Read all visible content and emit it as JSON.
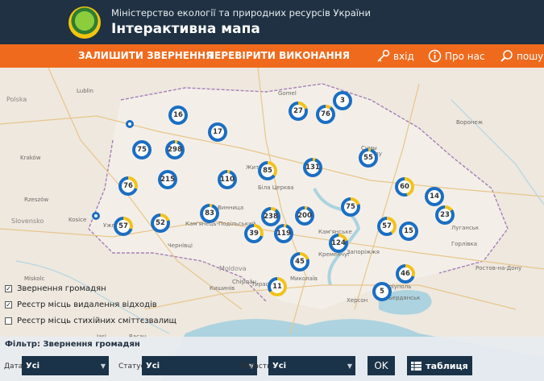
{
  "header": {
    "ministry": "Міністерство екології та природних ресурсів України",
    "title": "Інтерактивна мапа",
    "logo_icon": "ministry-emblem"
  },
  "nav": {
    "submit": "ЗАЛИШИТИ ЗВЕРНЕННЯ",
    "check": "ПЕРЕВІРИТИ ВИКОНАННЯ",
    "login": "вхід",
    "about": "Про нас",
    "search": "пошук",
    "accent": "#ef6a1d"
  },
  "map_labels": [
    {
      "text": "Polska",
      "cls": "country"
    },
    {
      "text": "Slovensko",
      "cls": "country"
    },
    {
      "text": "Moldova",
      "cls": "country"
    },
    {
      "text": "Gomel",
      "cls": ""
    },
    {
      "text": "Сумы",
      "cls": ""
    },
    {
      "text": "Воронеж",
      "cls": ""
    },
    {
      "text": "Kraków",
      "cls": ""
    },
    {
      "text": "Rzeszów",
      "cls": ""
    },
    {
      "text": "Lublin",
      "cls": ""
    },
    {
      "text": "Житомир",
      "cls": ""
    },
    {
      "text": "Біла Церква",
      "cls": ""
    },
    {
      "text": "Винница",
      "cls": ""
    },
    {
      "text": "Кам'янець-Подільський",
      "cls": ""
    },
    {
      "text": "Ужгород",
      "cls": ""
    },
    {
      "text": "Чернівці",
      "cls": ""
    },
    {
      "text": "Кременчуг",
      "cls": ""
    },
    {
      "text": "Запоріжжя",
      "cls": ""
    },
    {
      "text": "Кам'янське",
      "cls": ""
    },
    {
      "text": "Маріуполь",
      "cls": ""
    },
    {
      "text": "Бердянськ",
      "cls": ""
    },
    {
      "text": "Луганськ",
      "cls": ""
    },
    {
      "text": "Ростов-на-Дону",
      "cls": ""
    },
    {
      "text": "Миколаїв",
      "cls": ""
    },
    {
      "text": "Chişinău",
      "cls": ""
    },
    {
      "text": "Тирасполь",
      "cls": ""
    },
    {
      "text": "Херсон",
      "cls": ""
    },
    {
      "text": "Кишинів",
      "cls": ""
    },
    {
      "text": "Горлівка",
      "cls": ""
    },
    {
      "text": "Kosice",
      "cls": ""
    },
    {
      "text": "Miskolc",
      "cls": ""
    },
    {
      "text": "Iasi",
      "cls": ""
    },
    {
      "text": "Bacau",
      "cls": ""
    },
    {
      "text": "Sumy",
      "cls": ""
    }
  ],
  "clusters": [
    {
      "count": "3",
      "yellow": 0
    },
    {
      "count": "27",
      "yellow": 0.2
    },
    {
      "count": "76",
      "yellow": 0.1
    },
    {
      "count": "16",
      "yellow": 0
    },
    {
      "count": "17",
      "yellow": 0
    },
    {
      "count": "75",
      "yellow": 0
    },
    {
      "count": "298",
      "yellow": 0.05
    },
    {
      "count": "215",
      "yellow": 0
    },
    {
      "count": "76",
      "yellow": 0.3
    },
    {
      "count": "110",
      "yellow": 0.05
    },
    {
      "count": "85",
      "yellow": 0.35
    },
    {
      "count": "131",
      "yellow": 0.05
    },
    {
      "count": "55",
      "yellow": 0.05
    },
    {
      "count": "60",
      "yellow": 0.45
    },
    {
      "count": "14",
      "yellow": 0
    },
    {
      "count": "23",
      "yellow": 0.15
    },
    {
      "count": "57",
      "yellow": 0.3
    },
    {
      "count": "52",
      "yellow": 0.2
    },
    {
      "count": "83",
      "yellow": 0.05
    },
    {
      "count": "238",
      "yellow": 0.1
    },
    {
      "count": "200",
      "yellow": 0.05
    },
    {
      "count": "75",
      "yellow": 0.2
    },
    {
      "count": "57",
      "yellow": 0.4
    },
    {
      "count": "15",
      "yellow": 0
    },
    {
      "count": "39",
      "yellow": 0.3
    },
    {
      "count": "119",
      "yellow": 0.05
    },
    {
      "count": "124",
      "yellow": 0.2
    },
    {
      "count": "45",
      "yellow": 0.2
    },
    {
      "count": "46",
      "yellow": 0.3
    },
    {
      "count": "11",
      "yellow": 0.65
    },
    {
      "count": "5",
      "yellow": 0
    }
  ],
  "layers": [
    {
      "label": "Звернення громадян",
      "checked": true
    },
    {
      "label": "Реєстр місць видалення відходів",
      "checked": true
    },
    {
      "label": "Реєстр місць стихійних сміттєзвалищ",
      "checked": false
    }
  ],
  "filter": {
    "title": "Фільтр: Звернення громадян",
    "date_label": "Дата",
    "date_value": "Усі",
    "status_label": "Статус",
    "status_value": "Усі",
    "region_label": "Область",
    "region_value": "Усі",
    "ok": "OK",
    "table": "таблиця",
    "table_icon": "table-icon"
  },
  "colors": {
    "cluster_blue": "#1b6ec2",
    "cluster_yellow": "#f2c21b",
    "header_bg": "#1f3142"
  }
}
